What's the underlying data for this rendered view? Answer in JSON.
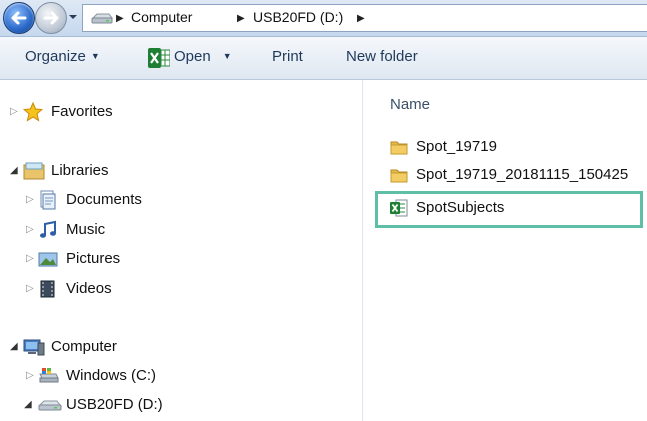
{
  "address_bar": {
    "breadcrumbs": [
      "Computer",
      "USB20FD (D:)"
    ]
  },
  "toolbar": {
    "organize_label": "Organize",
    "open_label": "Open",
    "print_label": "Print",
    "new_folder_label": "New folder"
  },
  "nav": {
    "favorites": "Favorites",
    "libraries": "Libraries",
    "documents": "Documents",
    "music": "Music",
    "pictures": "Pictures",
    "videos": "Videos",
    "computer": "Computer",
    "windows_drive": "Windows (C:)",
    "usb_drive": "USB20FD (D:)"
  },
  "file_list": {
    "column_name": "Name",
    "items": [
      {
        "name": "Spot_19719",
        "icon": "folder-icon"
      },
      {
        "name": "Spot_19719_20181115_150425",
        "icon": "folder-icon"
      },
      {
        "name": "SpotSubjects",
        "icon": "excel-file-icon"
      }
    ]
  },
  "colors": {
    "highlight": "#5fbfa6",
    "toolbar_text": "#1e395b"
  }
}
